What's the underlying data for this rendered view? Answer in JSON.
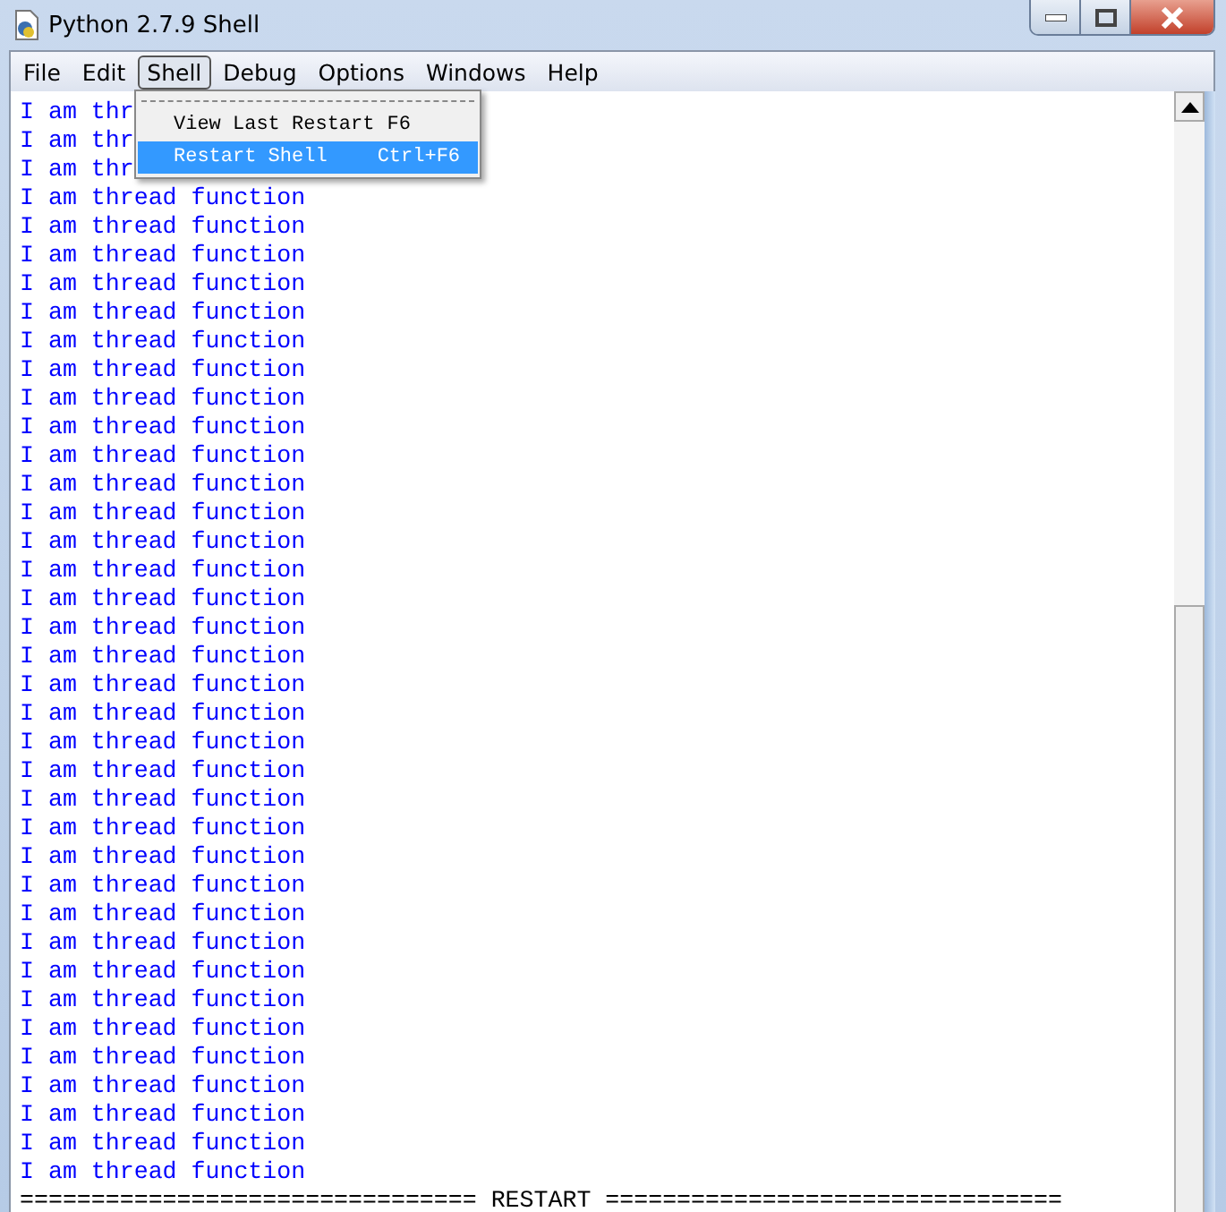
{
  "window": {
    "title": "Python 2.7.9 Shell"
  },
  "menubar": [
    {
      "label": "File",
      "selected": false
    },
    {
      "label": "Edit",
      "selected": false
    },
    {
      "label": "Shell",
      "selected": true
    },
    {
      "label": "Debug",
      "selected": false
    },
    {
      "label": "Options",
      "selected": false
    },
    {
      "label": "Windows",
      "selected": false
    },
    {
      "label": "Help",
      "selected": false
    }
  ],
  "shell_menu": {
    "items": [
      {
        "label": "View Last Restart",
        "shortcut": "F6",
        "selected": false
      },
      {
        "label": "Restart Shell",
        "shortcut": "Ctrl+F6",
        "selected": true
      }
    ]
  },
  "output": {
    "lines": [
      "I am thr",
      "I am thr",
      "I am thr",
      "I am thread function",
      "I am thread function",
      "I am thread function",
      "I am thread function",
      "I am thread function",
      "I am thread function",
      "I am thread function",
      "I am thread function",
      "I am thread function",
      "I am thread function",
      "I am thread function",
      "I am thread function",
      "I am thread function",
      "I am thread function",
      "I am thread function",
      "I am thread function",
      "I am thread function",
      "I am thread function",
      "I am thread function",
      "I am thread function",
      "I am thread function",
      "I am thread function",
      "I am thread function",
      "I am thread function",
      "I am thread function",
      "I am thread function",
      "I am thread function",
      "I am thread function",
      "I am thread function",
      "I am thread function",
      "I am thread function",
      "I am thread function",
      "I am thread function",
      "I am thread function",
      "I am thread function"
    ],
    "restart_line": "================================ RESTART ================================"
  }
}
